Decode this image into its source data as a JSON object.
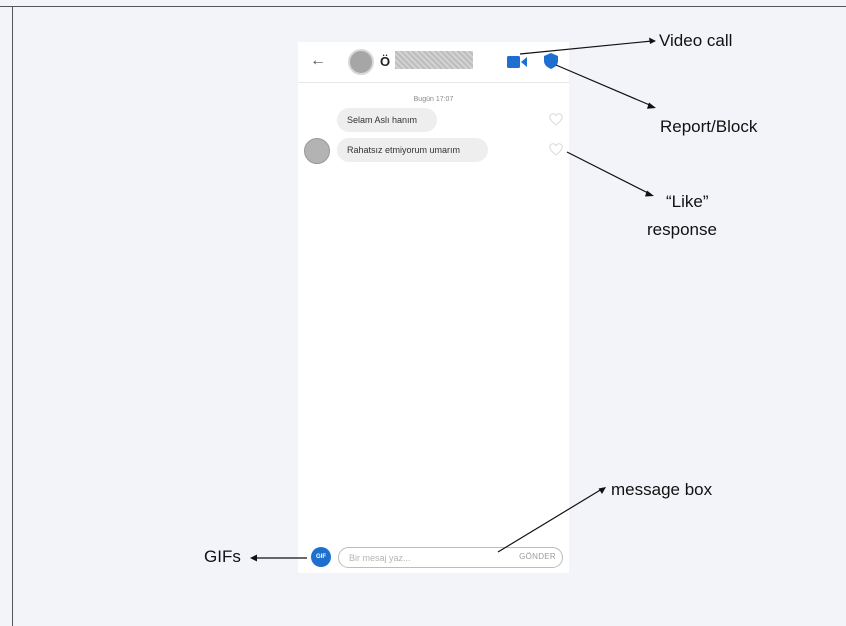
{
  "chat": {
    "header": {
      "back_icon": "arrow-left-icon",
      "contact_name_visible": "Ö",
      "video_call_icon": "video-camera-icon",
      "report_block_icon": "shield-icon"
    },
    "timestamp": "Bugün 17:07",
    "messages": [
      {
        "text": "Selam Aslı hanım"
      },
      {
        "text": "Rahatsız etmiyorum umarım"
      }
    ],
    "composer": {
      "gif_label": "GIF",
      "placeholder": "Bir mesaj yaz...",
      "send_label": "GÖNDER"
    }
  },
  "annotations": {
    "video_call": "Video call",
    "report_block": "Report/Block",
    "like_line1": "“Like”",
    "like_line2": "response",
    "message_box": "message box",
    "gifs": "GIFs"
  },
  "colors": {
    "accent": "#1f6fd1",
    "background": "#f2f4f9",
    "bubble": "#eeeeee"
  }
}
